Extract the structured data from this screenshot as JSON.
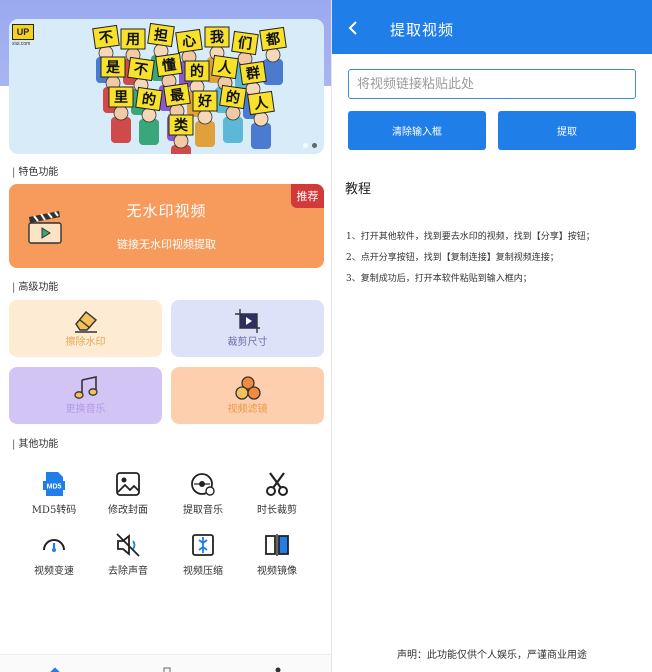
{
  "left": {
    "banner": {
      "logo_text": "UP",
      "logo_sub": "xiui.com",
      "sign_words": [
        "不",
        "用",
        "担",
        "心",
        "我",
        "们",
        "都",
        "是",
        "不",
        "懂",
        "的",
        "人",
        "群",
        "里",
        "的",
        "最",
        "好",
        "的",
        "人",
        "类"
      ],
      "carousel": {
        "count": 2,
        "active": 1
      }
    },
    "sections": {
      "featured": "特色功能",
      "advanced": "高级功能",
      "other": "其他功能"
    },
    "featured_card": {
      "title": "无水印视频",
      "subtitle": "链接无水印视频提取",
      "badge": "推荐",
      "icon": "clapperboard-icon",
      "color": "#f79b5c"
    },
    "advanced": [
      {
        "label": "擦除水印",
        "icon": "eraser-icon",
        "bg": "#fdebd3",
        "color": "#e3a956"
      },
      {
        "label": "裁剪尺寸",
        "icon": "crop-icon",
        "bg": "#dde2f8",
        "color": "#6a6fa8"
      },
      {
        "label": "更换音乐",
        "icon": "music-note-icon",
        "bg": "#d3c4f6",
        "color": "#b49ae8"
      },
      {
        "label": "视频滤镜",
        "icon": "filter-circles-icon",
        "bg": "#fdcfae",
        "color": "#e89a4a"
      }
    ],
    "other": [
      {
        "label": "MD5转码",
        "icon": "md5-file-icon"
      },
      {
        "label": "修改封面",
        "icon": "image-icon"
      },
      {
        "label": "提取音乐",
        "icon": "disc-icon"
      },
      {
        "label": "时长裁剪",
        "icon": "scissors-icon"
      },
      {
        "label": "视频变速",
        "icon": "speedometer-icon"
      },
      {
        "label": "去除声音",
        "icon": "mute-icon"
      },
      {
        "label": "视频压缩",
        "icon": "compress-icon"
      },
      {
        "label": "视频镜像",
        "icon": "mirror-icon"
      }
    ]
  },
  "right": {
    "header": {
      "title": "提取视频",
      "back_icon": "chevron-left-icon",
      "color": "#1f7ee8"
    },
    "input": {
      "value": "",
      "placeholder": "将视频链接粘贴此处"
    },
    "buttons": {
      "clear": "清除输入框",
      "extract": "提取"
    },
    "tutorial": {
      "title": "教程",
      "steps": [
        "1、打开其他软件，找到要去水印的视频，找到【分享】按钮；",
        "2、点开分享按钮，找到【复制连接】复制视频连接；",
        "3、复制成功后，打开本软件粘贴到输入框内；"
      ]
    },
    "disclaimer": "声明：此功能仅供个人娱乐，严谨商业用途"
  }
}
